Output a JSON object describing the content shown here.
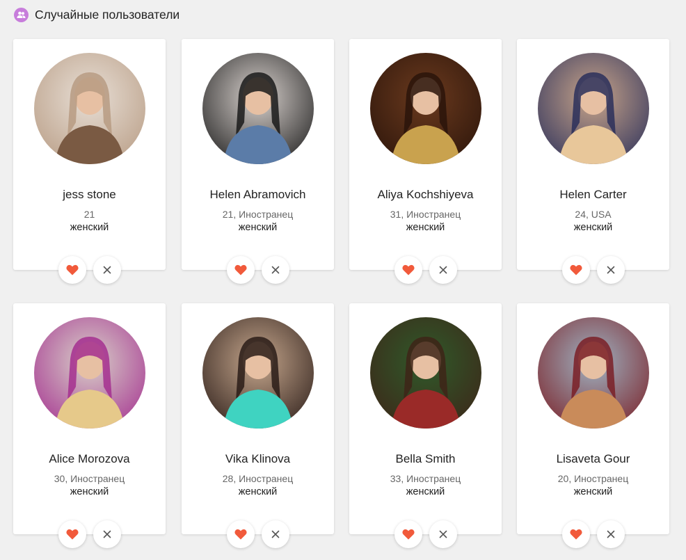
{
  "header": {
    "title": "Случайные пользователи",
    "icon": "users-icon",
    "icon_color": "#c77ddb"
  },
  "colors": {
    "like": "#f15a3b",
    "dismiss": "#555555"
  },
  "users": [
    {
      "name": "jess stone",
      "meta": "21",
      "gender": "женский",
      "palette": [
        "#e8dfd6",
        "#b79b83",
        "#7a5a43"
      ]
    },
    {
      "name": "Helen Abramovich",
      "meta": "21, Иностранец",
      "gender": "женский",
      "palette": [
        "#d9d2ce",
        "#1a1a1a",
        "#5b7ca8"
      ]
    },
    {
      "name": "Aliya Kochshiyeva",
      "meta": "31, Иностранец",
      "gender": "женский",
      "palette": [
        "#6b3a1e",
        "#2a140a",
        "#c9a24e"
      ]
    },
    {
      "name": "Helen Carter",
      "meta": "24, USA",
      "gender": "женский",
      "palette": [
        "#c9a58a",
        "#2a2f5a",
        "#e8c79a"
      ]
    },
    {
      "name": "Alice Morozova",
      "meta": "30, Иностранец",
      "gender": "женский",
      "palette": [
        "#d8d0c8",
        "#a42f8f",
        "#e6c98a"
      ]
    },
    {
      "name": "Vika Klinova",
      "meta": "28, Иностранец",
      "gender": "женский",
      "palette": [
        "#c6a78d",
        "#2a1c18",
        "#3fd3c1"
      ]
    },
    {
      "name": "Bella Smith",
      "meta": "33, Иностранец",
      "gender": "женский",
      "palette": [
        "#2f5a2a",
        "#3e2418",
        "#9a2a28"
      ]
    },
    {
      "name": "Lisaveta Gour",
      "meta": "20, Иностранец",
      "gender": "женский",
      "palette": [
        "#9fb3c2",
        "#7a1f26",
        "#c98b5a"
      ]
    }
  ]
}
